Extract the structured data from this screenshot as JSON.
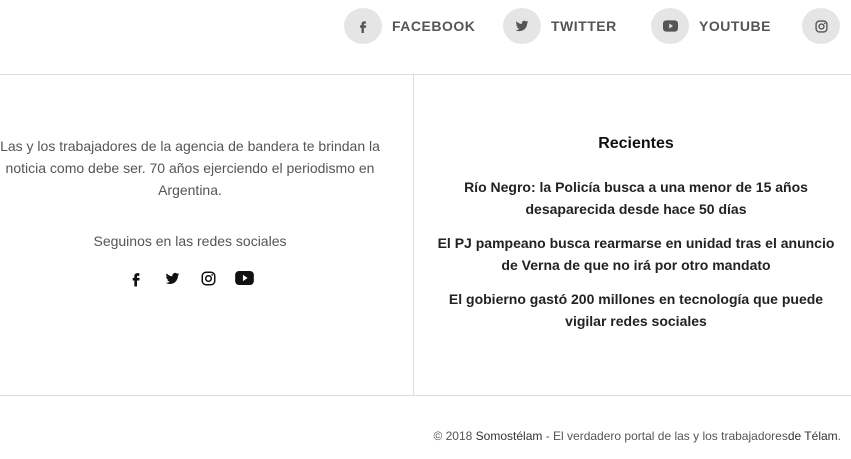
{
  "social_top": [
    {
      "label": "FACEBOOK",
      "icon": "facebook-icon"
    },
    {
      "label": "TWITTER",
      "icon": "twitter-icon"
    },
    {
      "label": "YOUTUBE",
      "icon": "youtube-icon"
    },
    {
      "label": "",
      "icon": "instagram-icon"
    }
  ],
  "about": {
    "text": "Las y los trabajadores de la agencia de bandera te brindan la noticia como debe ser. 70 años ejerciendo el periodismo en Argentina."
  },
  "follow": {
    "label": "Seguinos en las redes sociales",
    "icons": [
      "facebook-icon",
      "twitter-icon",
      "instagram-icon",
      "youtube-icon"
    ]
  },
  "recientes": {
    "title": "Recientes",
    "items": [
      "Río Negro: la Policía busca a una menor de 15 años desaparecida desde hace 50 días",
      "El PJ pampeano busca rearmarse en unidad tras el anuncio de Verna de que no irá por otro mandato",
      "El gobierno gastó 200 millones en tecnología que puede vigilar redes sociales"
    ]
  },
  "footer": {
    "prefix": "© 2018 ",
    "link1": "Somostélam",
    "middle": " - El verdadero portal de las y los trabajadores",
    "link2": "de Télam",
    "suffix": "."
  },
  "colors": {
    "icon_circle_bg": "#e5e5e5",
    "label_text": "#555555",
    "divider": "#dcdcdc"
  }
}
